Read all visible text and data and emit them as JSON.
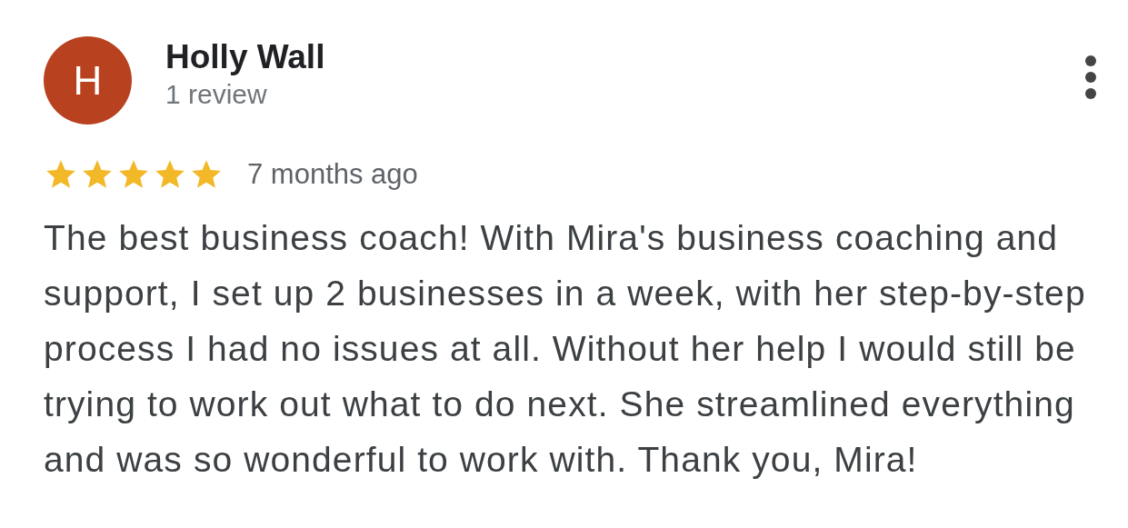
{
  "review": {
    "avatar_letter": "H",
    "author": "Holly Wall",
    "author_meta": "1 review",
    "stars": 5,
    "time": "7 months ago",
    "text": "The best business coach! With Mira's business coaching and support, I set up 2 businesses in a week, with her step-by-step process I had no issues at all. Without her help I would still be trying to work out what to do next. She streamlined everything and was so wonderful to work with. Thank you, Mira!"
  }
}
